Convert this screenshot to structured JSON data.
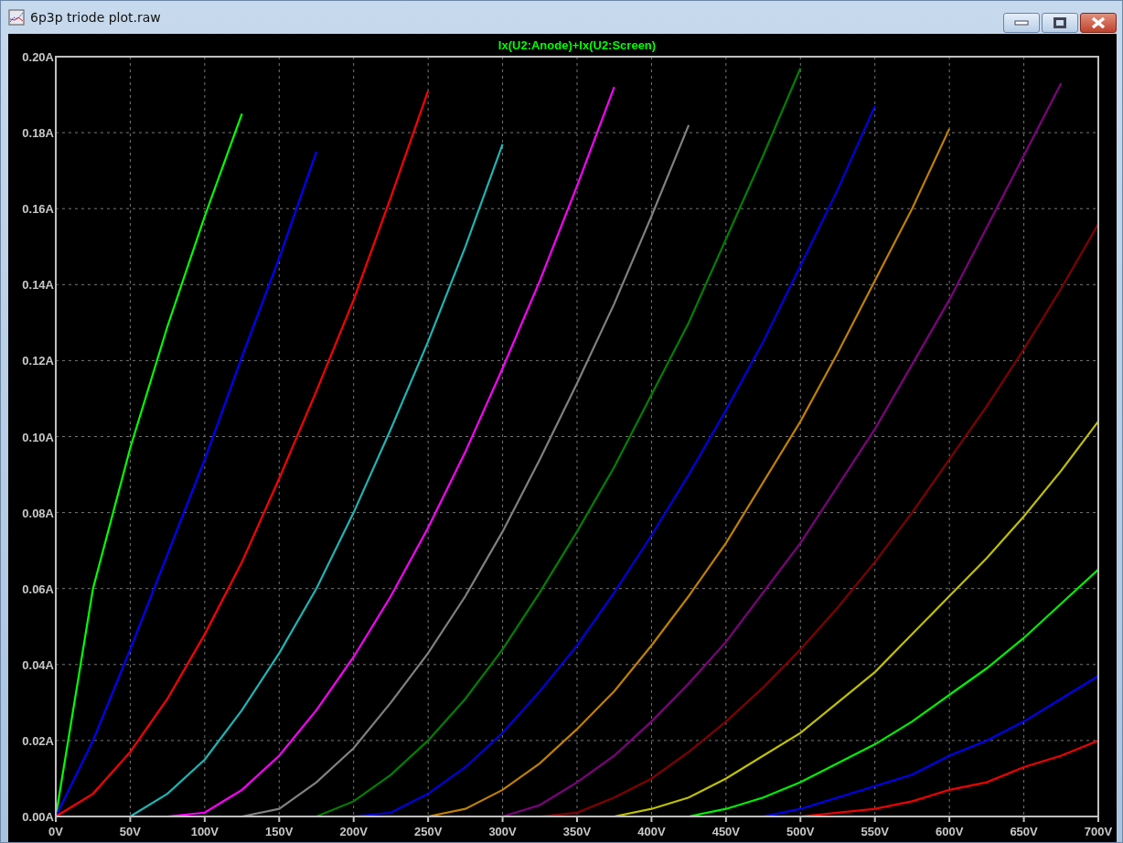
{
  "window": {
    "title": "6p3p triode plot.raw"
  },
  "plot": {
    "chart_data": {
      "type": "line",
      "title": "Ix(U2:Anode)+Ix(U2:Screen)",
      "grid": true,
      "x": [
        0,
        25,
        50,
        75,
        100,
        125,
        150,
        175,
        200,
        225,
        250,
        275,
        300,
        325,
        350,
        375,
        400,
        425,
        450,
        475,
        500,
        525,
        550,
        575,
        600,
        625,
        650,
        675,
        700
      ],
      "xlim": [
        0,
        700
      ],
      "ylim": [
        0,
        0.2
      ],
      "xticks": [
        {
          "value": 0,
          "label": "0V"
        },
        {
          "value": 50,
          "label": "50V"
        },
        {
          "value": 100,
          "label": "100V"
        },
        {
          "value": 150,
          "label": "150V"
        },
        {
          "value": 200,
          "label": "200V"
        },
        {
          "value": 250,
          "label": "250V"
        },
        {
          "value": 300,
          "label": "300V"
        },
        {
          "value": 350,
          "label": "350V"
        },
        {
          "value": 400,
          "label": "400V"
        },
        {
          "value": 450,
          "label": "450V"
        },
        {
          "value": 500,
          "label": "500V"
        },
        {
          "value": 550,
          "label": "550V"
        },
        {
          "value": 600,
          "label": "600V"
        },
        {
          "value": 650,
          "label": "650V"
        },
        {
          "value": 700,
          "label": "700V"
        }
      ],
      "yticks": [
        {
          "value": 0,
          "label": "0.00A"
        },
        {
          "value": 0.02,
          "label": "0.02A"
        },
        {
          "value": 0.04,
          "label": "0.04A"
        },
        {
          "value": 0.06,
          "label": "0.06A"
        },
        {
          "value": 0.08,
          "label": "0.08A"
        },
        {
          "value": 0.1,
          "label": "0.10A"
        },
        {
          "value": 0.12,
          "label": "0.12A"
        },
        {
          "value": 0.14,
          "label": "0.14A"
        },
        {
          "value": 0.16,
          "label": "0.16A"
        },
        {
          "value": 0.18,
          "label": "0.18A"
        },
        {
          "value": 0.2,
          "label": "0.20A"
        }
      ],
      "series": [
        {
          "color": "#00ff00",
          "values": [
            0,
            0.06,
            0.097,
            0.129,
            0.158,
            0.185,
            null,
            null,
            null,
            null,
            null,
            null,
            null,
            null,
            null,
            null,
            null,
            null,
            null,
            null,
            null,
            null,
            null,
            null,
            null,
            null,
            null,
            null,
            null
          ]
        },
        {
          "color": "#0000ff",
          "values": [
            0,
            0.02,
            0.044,
            0.069,
            0.094,
            0.121,
            0.147,
            0.175,
            null,
            null,
            null,
            null,
            null,
            null,
            null,
            null,
            null,
            null,
            null,
            null,
            null,
            null,
            null,
            null,
            null,
            null,
            null,
            null,
            null
          ]
        },
        {
          "color": "#ff0000",
          "values": [
            0,
            0.006,
            0.017,
            0.031,
            0.048,
            0.067,
            0.089,
            0.112,
            0.136,
            0.163,
            0.191,
            null,
            null,
            null,
            null,
            null,
            null,
            null,
            null,
            null,
            null,
            null,
            null,
            null,
            null,
            null,
            null,
            null,
            null
          ]
        },
        {
          "color": "#1fb4b4",
          "values": [
            null,
            null,
            0,
            0.006,
            0.015,
            0.028,
            0.043,
            0.06,
            0.08,
            0.102,
            0.125,
            0.15,
            0.177,
            null,
            null,
            null,
            null,
            null,
            null,
            null,
            null,
            null,
            null,
            null,
            null,
            null,
            null,
            null,
            null
          ]
        },
        {
          "color": "#ff00ff",
          "values": [
            null,
            null,
            null,
            0,
            0.001,
            0.007,
            0.016,
            0.028,
            0.042,
            0.058,
            0.076,
            0.096,
            0.118,
            0.141,
            0.166,
            0.192,
            null,
            null,
            null,
            null,
            null,
            null,
            null,
            null,
            null,
            null,
            null,
            null,
            null
          ]
        },
        {
          "color": "#808080",
          "values": [
            null,
            null,
            null,
            null,
            null,
            0,
            0.002,
            0.009,
            0.018,
            0.03,
            0.043,
            0.058,
            0.075,
            0.094,
            0.114,
            0.135,
            0.158,
            0.182,
            null,
            null,
            null,
            null,
            null,
            null,
            null,
            null,
            null,
            null,
            null
          ]
        },
        {
          "color": "#008000",
          "values": [
            null,
            null,
            null,
            null,
            null,
            null,
            null,
            0,
            0.004,
            0.011,
            0.02,
            0.031,
            0.044,
            0.059,
            0.075,
            0.092,
            0.111,
            0.13,
            0.152,
            0.174,
            0.197,
            null,
            null,
            null,
            null,
            null,
            null,
            null,
            null
          ]
        },
        {
          "color": "#0000e0",
          "values": [
            null,
            null,
            null,
            null,
            null,
            null,
            null,
            null,
            0,
            0.001,
            0.006,
            0.013,
            0.022,
            0.033,
            0.045,
            0.059,
            0.074,
            0.09,
            0.107,
            0.125,
            0.145,
            0.165,
            0.187,
            null,
            null,
            null,
            null,
            null,
            null
          ]
        },
        {
          "color": "#c08000",
          "values": [
            null,
            null,
            null,
            null,
            null,
            null,
            null,
            null,
            null,
            null,
            0,
            0.002,
            0.007,
            0.014,
            0.023,
            0.033,
            0.045,
            0.058,
            0.072,
            0.088,
            0.104,
            0.122,
            0.141,
            0.16,
            0.181,
            null,
            null,
            null,
            null
          ]
        },
        {
          "color": "#800080",
          "values": [
            null,
            null,
            null,
            null,
            null,
            null,
            null,
            null,
            null,
            null,
            null,
            null,
            0,
            0.003,
            0.009,
            0.016,
            0.025,
            0.035,
            0.046,
            0.059,
            0.072,
            0.087,
            0.102,
            0.119,
            0.136,
            0.155,
            0.174,
            0.193,
            null
          ]
        },
        {
          "color": "#800000",
          "values": [
            null,
            null,
            null,
            null,
            null,
            null,
            null,
            null,
            null,
            null,
            null,
            null,
            null,
            0,
            0.001,
            0.005,
            0.01,
            0.017,
            0.025,
            0.034,
            0.044,
            0.055,
            0.067,
            0.08,
            0.094,
            0.108,
            0.123,
            0.139,
            0.156
          ]
        },
        {
          "color": "#c0c000",
          "values": [
            null,
            null,
            null,
            null,
            null,
            null,
            null,
            null,
            null,
            null,
            null,
            null,
            null,
            null,
            null,
            0,
            0.002,
            0.005,
            0.01,
            0.016,
            0.022,
            0.03,
            0.038,
            0.048,
            0.058,
            0.068,
            0.079,
            0.091,
            0.104
          ]
        },
        {
          "color": "#00f000",
          "values": [
            null,
            null,
            null,
            null,
            null,
            null,
            null,
            null,
            null,
            null,
            null,
            null,
            null,
            null,
            null,
            null,
            null,
            0,
            0.002,
            0.005,
            0.009,
            0.014,
            0.019,
            0.025,
            0.032,
            0.039,
            0.047,
            0.056,
            0.065
          ]
        },
        {
          "color": "#0000f0",
          "values": [
            null,
            null,
            null,
            null,
            null,
            null,
            null,
            null,
            null,
            null,
            null,
            null,
            null,
            null,
            null,
            null,
            null,
            null,
            null,
            0,
            0.002,
            0.005,
            0.008,
            0.011,
            0.016,
            0.02,
            0.025,
            0.031,
            0.037
          ]
        },
        {
          "color": "#f00000",
          "values": [
            null,
            null,
            null,
            null,
            null,
            null,
            null,
            null,
            null,
            null,
            null,
            null,
            null,
            null,
            null,
            null,
            null,
            null,
            null,
            null,
            0,
            0.001,
            0.002,
            0.004,
            0.007,
            0.009,
            0.013,
            0.016,
            0.02
          ]
        }
      ]
    }
  }
}
